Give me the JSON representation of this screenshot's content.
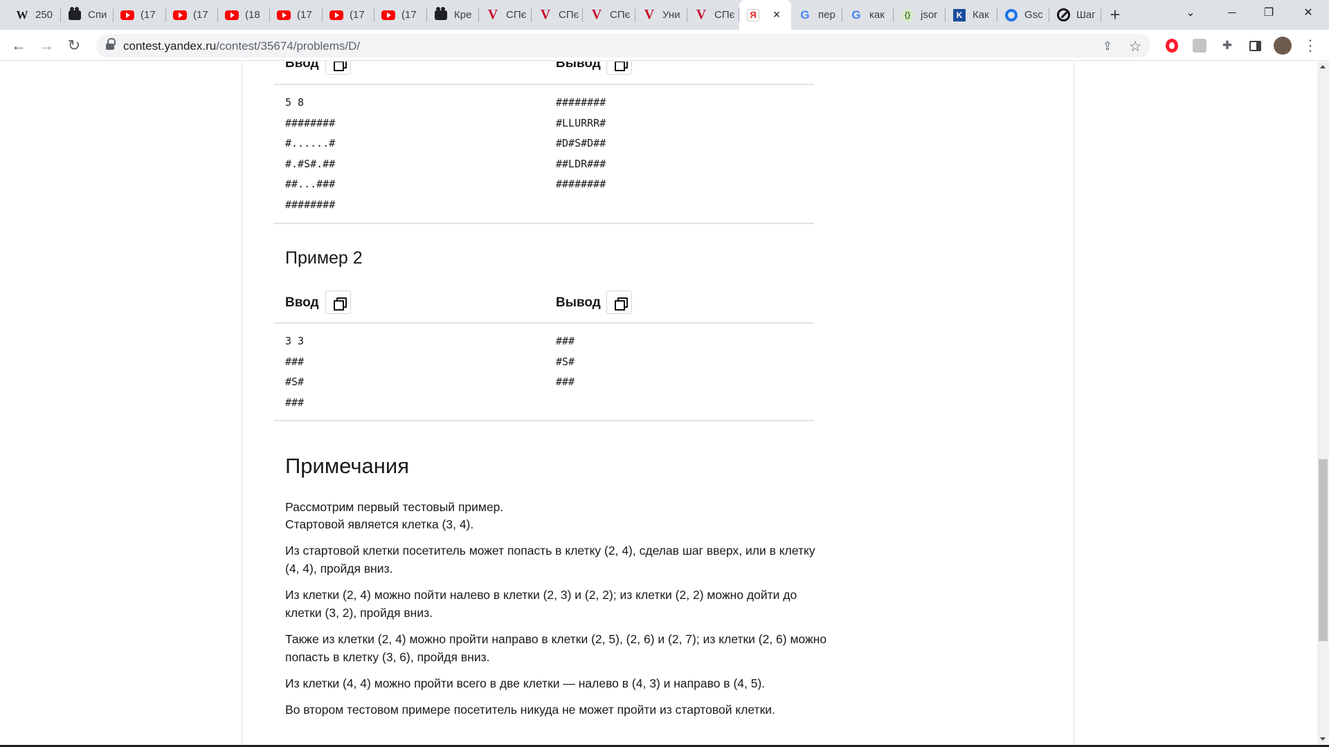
{
  "browser": {
    "tabs": [
      {
        "icon": "wikipedia-icon",
        "title": "250"
      },
      {
        "icon": "camera-icon",
        "title": "Спи"
      },
      {
        "icon": "youtube-icon",
        "title": "(17"
      },
      {
        "icon": "youtube-icon",
        "title": "(17"
      },
      {
        "icon": "youtube-icon",
        "title": "(18"
      },
      {
        "icon": "youtube-icon",
        "title": "(17"
      },
      {
        "icon": "youtube-icon",
        "title": "(17"
      },
      {
        "icon": "youtube-icon",
        "title": "(17"
      },
      {
        "icon": "camera-icon",
        "title": "Кре"
      },
      {
        "icon": "v-icon",
        "title": "СПє"
      },
      {
        "icon": "v-icon",
        "title": "СПє"
      },
      {
        "icon": "v-icon",
        "title": "СПє"
      },
      {
        "icon": "v-icon",
        "title": "Уни"
      },
      {
        "icon": "v-icon",
        "title": "СПє"
      },
      {
        "icon": "yandex-icon",
        "title": "Я",
        "active": true
      },
      {
        "icon": "google-icon",
        "title": "пер"
      },
      {
        "icon": "google-icon",
        "title": "как"
      },
      {
        "icon": "json-icon",
        "title": "jsor"
      },
      {
        "icon": "book-icon",
        "title": "Как"
      },
      {
        "icon": "o-icon",
        "title": "Gsc"
      },
      {
        "icon": "step-icon",
        "title": "Шаг"
      }
    ],
    "address": {
      "host": "contest.yandex.ru",
      "path": "/contest/35674/problems/D/"
    },
    "glyphs": {
      "back": "←",
      "forward": "→",
      "reload": "↻",
      "new_tab": "+",
      "close": "×",
      "minimize": "⌄",
      "restore": "❐",
      "window_close": "✕",
      "share": "⇪",
      "star": "☆",
      "puzzle": "✚",
      "sidebar": "▮",
      "menu": "⋮"
    }
  },
  "examples": [
    {
      "title": "",
      "input_label": "Ввод",
      "output_label": "Вывод",
      "input_lines": [
        "5 8",
        "########",
        "#......#",
        "#.#S#.##",
        "##...###",
        "########"
      ],
      "output_lines": [
        "########",
        "#LLURRR#",
        "#D#S#D##",
        "##LDR###",
        "########"
      ]
    },
    {
      "title": "Пример 2",
      "input_label": "Ввод",
      "output_label": "Вывод",
      "input_lines": [
        "3 3",
        "###",
        "#S#",
        "###"
      ],
      "output_lines": [
        "###",
        "#S#",
        "###"
      ]
    }
  ],
  "notes": {
    "title": "Примечания",
    "paragraphs": [
      "Рассмотрим первый тестовый пример.",
      "Стартовой является клетка (3, 4).",
      "Из стартовой клетки посетитель может попасть в клетку (2, 4), сделав шаг вверх, или в клетку (4, 4), пройдя вниз.",
      "Из клетки (2, 4) можно пойти налево в клетки (2, 3) и (2, 2); из клетки (2, 2) можно дойти до клетки (3, 2), пройдя вниз.",
      "Также из клетки (2, 4) можно пройти направо в клетки (2, 5), (2, 6) и (2, 7); из клетки (2, 6) можно попасть в клетку (3, 6), пройдя вниз.",
      "Из клетки (4, 4) можно пройти всего в две клетки — налево в (4, 3) и направо в (4, 5).",
      "Во втором тестовом примере посетитель никуда не может пройти из стартовой клетки."
    ]
  },
  "colors": {
    "tabstrip": "#dee1e6",
    "youtube": "#ff0000",
    "v_logo": "#c8102e",
    "opera": "#ff1b2d",
    "text": "#1a1a1a"
  }
}
